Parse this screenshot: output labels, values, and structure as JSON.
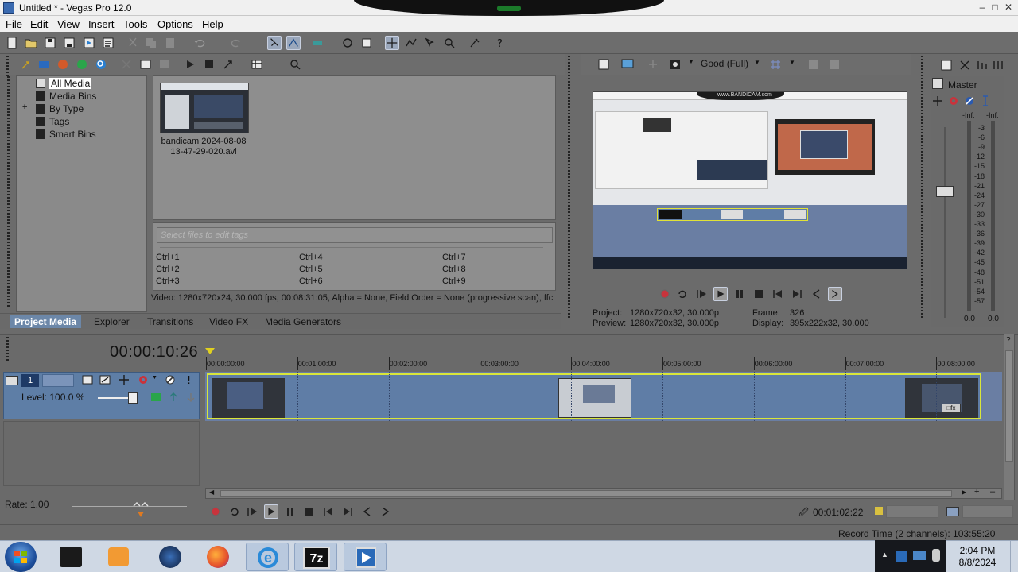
{
  "window": {
    "title": "Untitled * - Vegas Pro 12.0"
  },
  "menu": [
    "File",
    "Edit",
    "View",
    "Insert",
    "Tools",
    "Options",
    "Help"
  ],
  "project_media": {
    "tree": [
      "All Media",
      "Media Bins",
      "By Type",
      "Tags",
      "Smart Bins"
    ],
    "media_file": {
      "name_line1": "bandicam 2024-08-08",
      "name_line2": "13-47-29-020.avi"
    },
    "tag_placeholder": "Select files to edit tags",
    "tag_shortcuts": [
      "Ctrl+1",
      "Ctrl+2",
      "Ctrl+3",
      "Ctrl+4",
      "Ctrl+5",
      "Ctrl+6",
      "Ctrl+7",
      "Ctrl+8",
      "Ctrl+9"
    ],
    "info": "Video: 1280x720x24, 30.000 fps, 00:08:31:05, Alpha = None, Field Order = None (progressive scan), ffc"
  },
  "tabs": [
    "Project Media",
    "Explorer",
    "Transitions",
    "Video FX",
    "Media Generators"
  ],
  "preview": {
    "quality": "Good (Full)",
    "project_label": "Project:",
    "project_value": "1280x720x32, 30.000p",
    "preview_label": "Preview:",
    "preview_value": "1280x720x32, 30.000p",
    "frame_label": "Frame:",
    "frame_value": "326",
    "display_label": "Display:",
    "display_value": "395x222x32, 30.000",
    "watermark": "www.BANDICAM.com"
  },
  "master": {
    "label": "Master",
    "left_inf": "-Inf.",
    "right_inf": "-Inf.",
    "scale": [
      "3",
      "6",
      "9",
      "12",
      "15",
      "18",
      "21",
      "24",
      "27",
      "30",
      "33",
      "36",
      "39",
      "42",
      "45",
      "48",
      "51",
      "54",
      "57"
    ],
    "bottom_left": "0.0",
    "bottom_right": "0.0"
  },
  "timeline": {
    "timecode": "00:00:10:26",
    "track_number": "1",
    "level": "Level: 100.0 %",
    "ruler": [
      "00:00:00:00",
      "00:01:00:00",
      "00:02:00:00",
      "00:03:00:00",
      "00:04:00:00",
      "00:05:00:00",
      "00:06:00:00",
      "00:07:00:00",
      "00:08:00:00"
    ],
    "rate": "Rate: 1.00",
    "position": "00:01:02:22",
    "record_time": "Record Time (2 channels): 103:55:20"
  },
  "taskbar": {
    "time": "2:04 PM",
    "date": "8/8/2024",
    "app_7z_label": "7z"
  },
  "colors": {
    "selection_tab": "#6c87a8",
    "clip_outline": "#d9e63a",
    "track_header": "#5e7ea6",
    "record_red": "#d0202a"
  }
}
